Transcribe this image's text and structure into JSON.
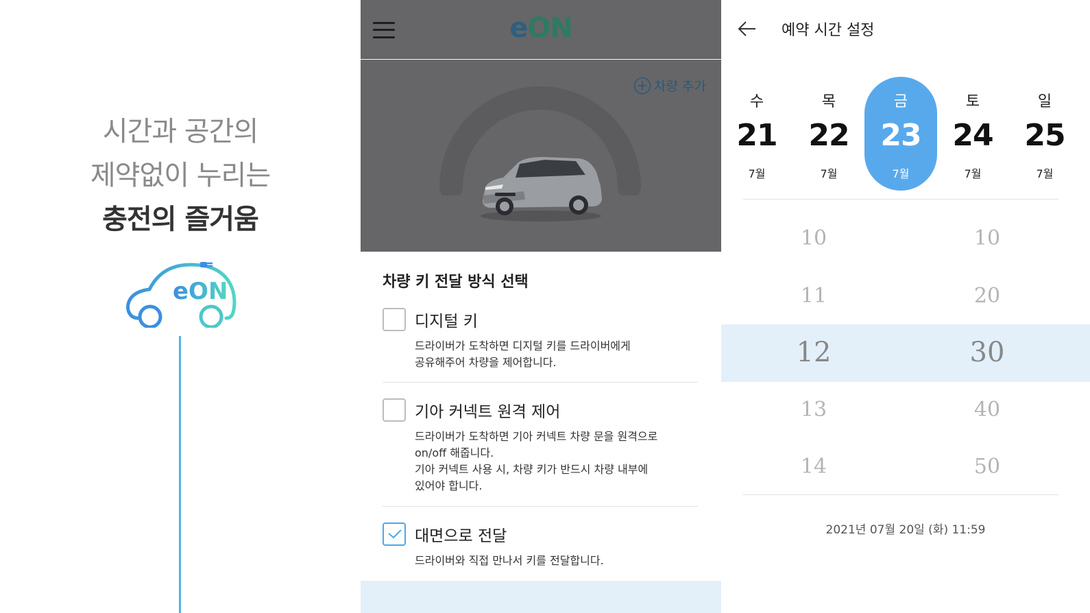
{
  "intro": {
    "tagline_line1": "시간과 공간의",
    "tagline_line2": "제약없이 누리는",
    "tagline_line3": "충전의 즐거움",
    "logo_text": "eON"
  },
  "vehicle_screen": {
    "brand_e": "e",
    "brand_on": "ON",
    "add_vehicle_label": "차량 추가",
    "key_section_title": "차량 키 전달 방식 선택",
    "options": [
      {
        "title": "디지털 키",
        "checked": false,
        "desc": [
          "드라이버가 도착하면 디지털 키를 드라이버에게",
          "공유해주어 차량을 제어합니다."
        ]
      },
      {
        "title": "기아 커넥트 원격 제어",
        "checked": false,
        "desc": [
          "드라이버가 도착하면 기아 커넥트 차량 문을 원격으로",
          "on/off 해줍니다.",
          "기아 커넥트 사용 시, 차량 키가 반드시 차량 내부에",
          "있어야 합니다."
        ]
      },
      {
        "title": "대면으로 전달",
        "checked": true,
        "desc": [
          "드라이버와 직접 만나서 키를 전달합니다."
        ]
      }
    ],
    "colors": {
      "header_bg": "#666668",
      "accent": "#4ea7e6"
    }
  },
  "schedule_screen": {
    "title": "예약 시간 설정",
    "days": [
      {
        "weekday": "수",
        "date": "21",
        "month": "7월",
        "selected": false
      },
      {
        "weekday": "목",
        "date": "22",
        "month": "7월",
        "selected": false
      },
      {
        "weekday": "금",
        "date": "23",
        "month": "7월",
        "selected": true
      },
      {
        "weekday": "토",
        "date": "24",
        "month": "7월",
        "selected": false
      },
      {
        "weekday": "일",
        "date": "25",
        "month": "7월",
        "selected": false
      }
    ],
    "hours": [
      "10",
      "11",
      "12",
      "13",
      "14"
    ],
    "minutes": [
      "10",
      "20",
      "30",
      "40",
      "50"
    ],
    "selected_hour": "12",
    "selected_minute": "30",
    "current_time": "2021년 07월 20일 (화) 11:59",
    "colors": {
      "selected_day_bg": "#58a9ec",
      "picker_highlight": "#e3f0fa"
    }
  }
}
